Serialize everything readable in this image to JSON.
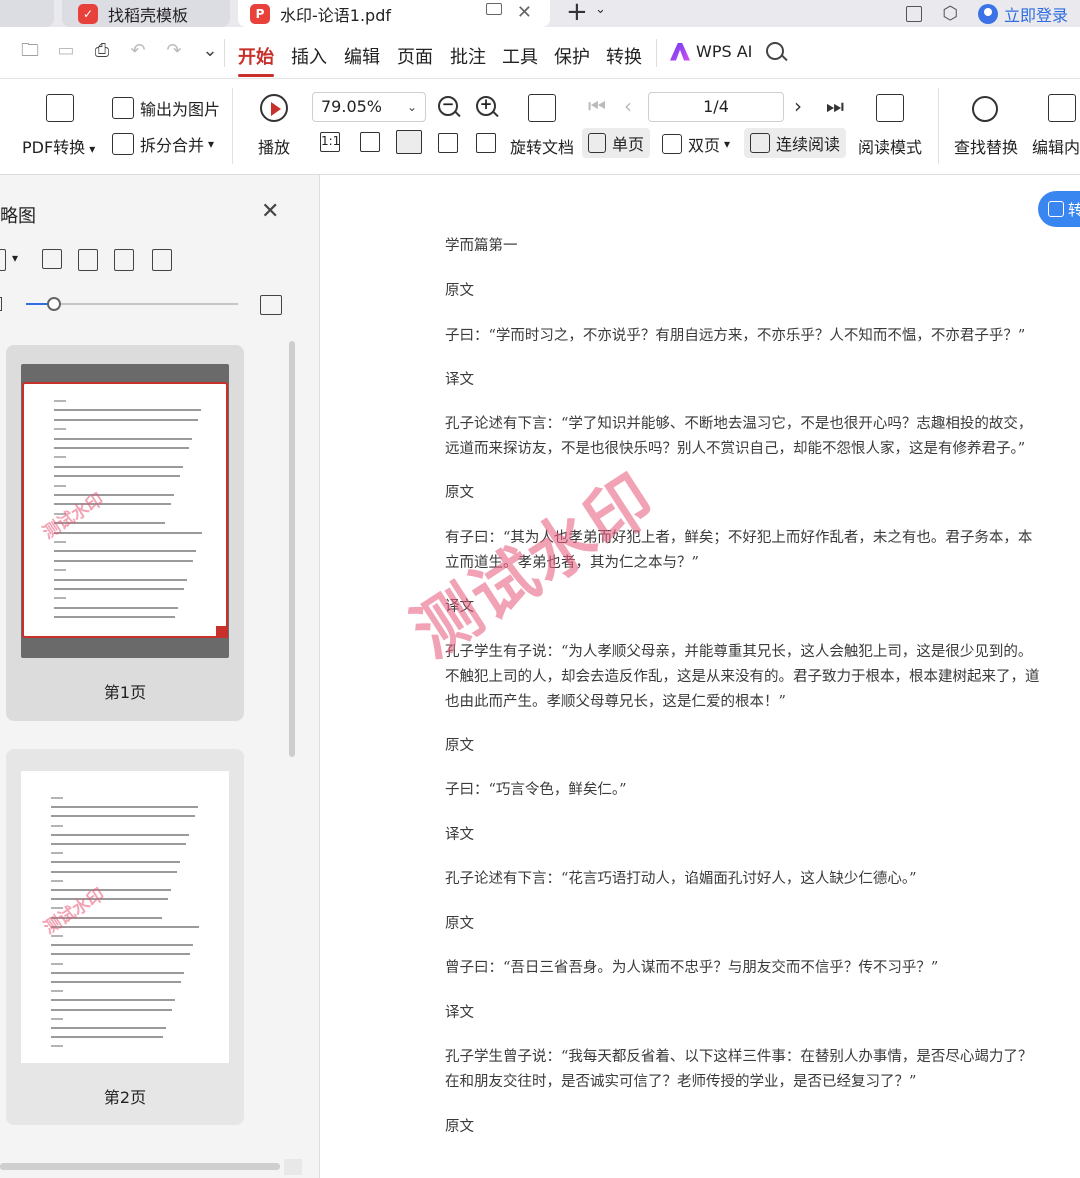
{
  "tabs": [
    {
      "label": ""
    },
    {
      "label": "找稻壳模板",
      "icon": "docer-logo-icon"
    },
    {
      "label": "水印-论语1.pdf",
      "icon": "pdf-logo-icon"
    }
  ],
  "titlebar": {
    "login_label": "立即登录"
  },
  "menu": {
    "items": [
      "开始",
      "插入",
      "编辑",
      "页面",
      "批注",
      "工具",
      "保护",
      "转换"
    ],
    "active": "开始",
    "ai_label": "WPS AI"
  },
  "ribbon": {
    "pdf_convert": "PDF转换",
    "export_image": "输出为图片",
    "split_merge": "拆分合并",
    "play": "播放",
    "zoom": "79.05%",
    "zoom_actual_size": "1:1",
    "page_indicator": "1/4",
    "rotate_doc": "旋转文档",
    "single_page": "单页",
    "double_page": "双页",
    "continuous_read": "连续阅读",
    "read_mode": "阅读模式",
    "find_replace": "查找替换",
    "edit_content": "编辑内"
  },
  "thumbnail_panel": {
    "title": "略图",
    "pages": [
      {
        "label": "第1页",
        "selected": true
      },
      {
        "label": "第2页",
        "selected": false
      }
    ],
    "watermark": "测试水印"
  },
  "document": {
    "convert_float_label": "转",
    "watermark": "测试水印",
    "paragraphs": [
      "学而篇第一",
      "原文",
      "子曰：“学而时习之，不亦说乎？有朋自远方来，不亦乐乎？人不知而不愠，不亦君子乎？”",
      "译文",
      "孔子论述有下言：“学了知识并能够、不断地去温习它，不是也很开心吗？志趣相投的故交，远道而来探访友，不是也很快乐吗？别人不赏识自己，却能不怨恨人家，这是有修养君子。”",
      "原文",
      "有子曰：“其为人也孝弟而好犯上者，鲜矣；不好犯上而好作乱者，未之有也。君子务本，本立而道生。孝弟也者，其为仁之本与？”",
      "译文",
      "孔子学生有子说：“为人孝顺父母亲，并能尊重其兄长，这人会触犯上司，这是很少见到的。不触犯上司的人，却会去造反作乱，这是从来没有的。君子致力于根本，根本建树起来了，道也由此而产生。孝顺父母尊兄长，这是仁爱的根本！”",
      "原文",
      "子曰：“巧言令色，鲜矣仁。”",
      "译文",
      "孔子论述有下言：“花言巧语打动人，谄媚面孔讨好人，这人缺少仁德心。”",
      "原文",
      "曾子曰：“吾日三省吾身。为人谋而不忠乎？与朋友交而不信乎？传不习乎？”",
      "译文",
      "孔子学生曾子说：“我每天都反省着、以下这样三件事：在替别人办事情，是否尽心竭力了？在和朋友交往时，是否诚实可信了？老师传授的学业，是否已经复习了？”",
      "原文"
    ]
  },
  "colors": {
    "accent_red": "#c8302b",
    "link_blue": "#2f6de0",
    "watermark_pink": "#e85f80"
  }
}
